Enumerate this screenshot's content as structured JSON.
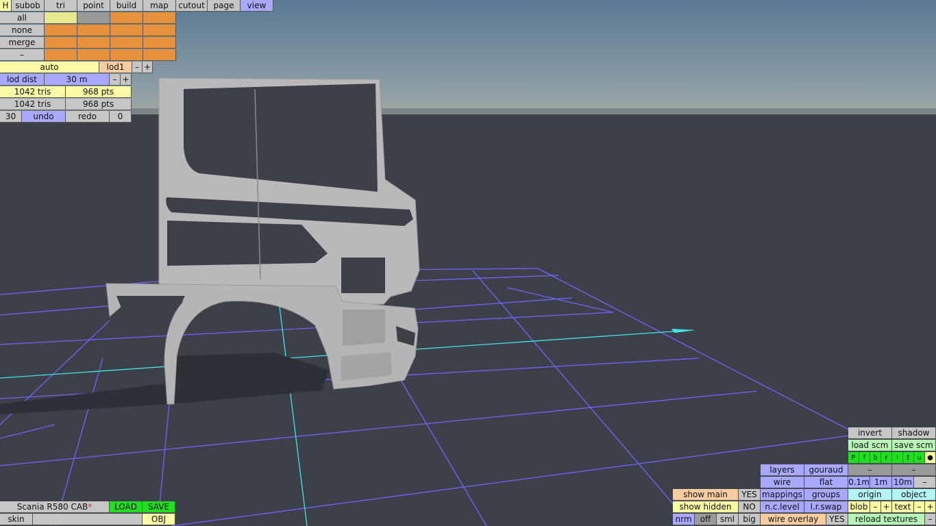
{
  "tabs": [
    "H",
    "subob",
    "tri",
    "point",
    "build",
    "map",
    "cutout",
    "page",
    "view"
  ],
  "select": {
    "all": "all",
    "none": "none",
    "merge": "merge",
    "minus": "–"
  },
  "lod": {
    "auto": "auto",
    "level": "lod1",
    "minus": "–",
    "plus": "+",
    "dist_label": "lod dist",
    "dist_value": "30 m"
  },
  "stats": [
    {
      "tris": "1042 tris",
      "pts": "968 pts"
    },
    {
      "tris": "1042 tris",
      "pts": "968 pts"
    }
  ],
  "undo": {
    "count": "30",
    "undo": "undo",
    "redo": "redo",
    "redo_count": "0"
  },
  "file": {
    "name": "Scania R580 CAB",
    "modified_mark": "*",
    "load": "LOAD",
    "save": "SAVE",
    "skin": "skin",
    "obj": "OBJ"
  },
  "view_panel": {
    "invert": "invert",
    "shadow": "shadow",
    "load_scm": "load scm",
    "save_scm": "save scm",
    "chars": [
      "P",
      "f",
      "b",
      "r",
      "l",
      "t",
      "u",
      "●"
    ],
    "dash": "–",
    "layers": "layers",
    "gouraud": "gouraud",
    "wire": "wire",
    "flat": "flat",
    "grid_sizes": [
      "0.1m",
      "1m",
      "10m"
    ],
    "mappings": "mappings",
    "groups": "groups",
    "origin": "origin",
    "object": "object",
    "nclevel": "n.c.level",
    "lrswap": "l.r.swap",
    "blob": "blob",
    "text": "text",
    "plus": "+",
    "show_main": "show main",
    "show_main_val": "YES",
    "show_hidden": "show hidden",
    "show_hidden_val": "NO",
    "sizes": [
      "nrm",
      "off",
      "sml",
      "big"
    ],
    "wire_overlay": "wire overlay",
    "wire_overlay_val": "YES",
    "reload_textures": "reload textures"
  },
  "colors": {
    "sky_top": "#5d7d97",
    "sky_bottom": "#93a2a6",
    "floor": "#3e4049",
    "grid": "#6060ff",
    "axis": "#40e0e0",
    "model": "#b8b8b8"
  }
}
